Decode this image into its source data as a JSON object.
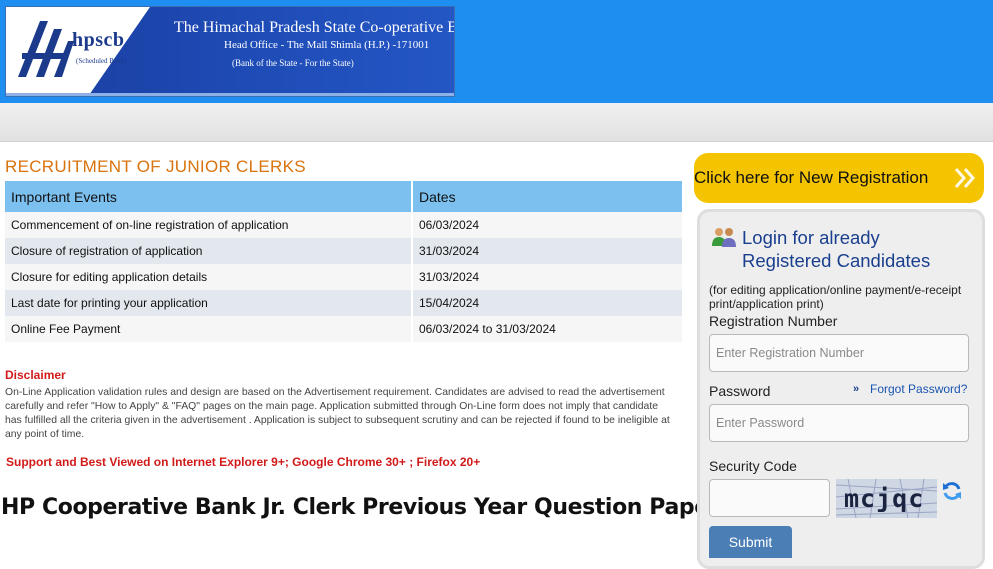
{
  "header": {
    "logo_text": "hpscb",
    "logo_subtext": "(Scheduled Bank)",
    "bank_name": "The Himachal Pradesh State Co-operative Bank Ltd.",
    "bank_address": "Head Office - The Mall Shimla (H.P.) -171001",
    "bank_tagline": "(Bank of the State - For the State)"
  },
  "main": {
    "title": "RECRUITMENT OF JUNIOR CLERKS",
    "table": {
      "headers": [
        "Important Events",
        "Dates"
      ],
      "rows": [
        [
          "Commencement of on-line registration of application",
          "06/03/2024"
        ],
        [
          "Closure of registration of application",
          "31/03/2024"
        ],
        [
          "Closure for editing application details",
          "31/03/2024"
        ],
        [
          "Last date for printing your application",
          "15/04/2024"
        ],
        [
          "Online Fee Payment",
          "06/03/2024 to 31/03/2024"
        ]
      ]
    },
    "disclaimer_title": "Disclaimer",
    "disclaimer_text": "On-Line Application validation rules and design are based on the Advertisement requirement. Candidates are advised to read the advertisement carefully and refer \"How to Apply\" & \"FAQ\" pages on the main page. Application submitted through On-Line form does not imply that candidate has fulfilled all the criteria given in the advertisement . Application is subject to subsequent scrutiny and can be rejected if found to be ineligible at any point of time.",
    "support_note": "Support and Best Viewed on Internet Explorer 9+; Google Chrome 30+ ; Firefox 20+",
    "article_title": "HP Cooperative Bank Jr. Clerk Previous Year Question Paper"
  },
  "sidebar": {
    "new_registration_label": "Click here for New Registration",
    "login_heading_line1": "Login for already",
    "login_heading_line2": "Registered Candidates",
    "login_note": "(for editing application/online payment/e-receipt print/application print)",
    "registration_label": "Registration Number",
    "registration_placeholder": "Enter Registration Number",
    "password_label": "Password",
    "password_placeholder": "Enter Password",
    "forgot_password": "Forgot Password?",
    "security_code_label": "Security Code",
    "captcha_text": "mcjqc",
    "submit_label": "Submit"
  },
  "colors": {
    "header_blue": "#1e8ff0",
    "title_orange": "#d9730d",
    "table_header": "#7cc0f0",
    "disclaimer_red": "#d11a1a",
    "registration_yellow": "#f5c400",
    "login_heading_blue": "#1a3f8f",
    "submit_blue": "#4a7eb5"
  },
  "icons": {
    "chevrons": "double-chevron-right-icon",
    "users": "users-icon",
    "refresh": "refresh-icon",
    "forgot": "double-chevron-small-icon"
  }
}
